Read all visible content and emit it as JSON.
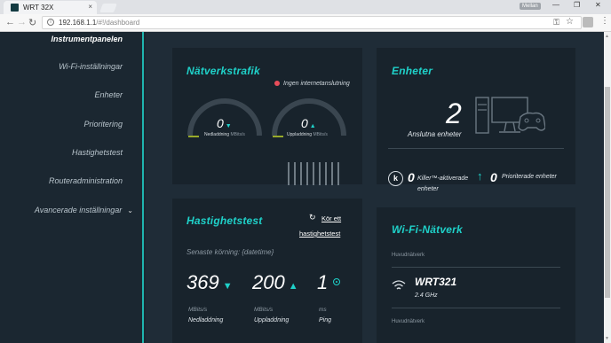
{
  "browser": {
    "tab_title": "WRT 32X",
    "tab_close": "×",
    "user_badge": "Mellan",
    "url_host": "192.168.1.1",
    "url_path": "/#!/dashboard",
    "win_min": "—",
    "win_restore": "❐",
    "win_close": "✕"
  },
  "sidebar": {
    "items": [
      {
        "label": "Instrumentpanelen"
      },
      {
        "label": "Wi-Fi-inställningar"
      },
      {
        "label": "Enheter"
      },
      {
        "label": "Prioritering"
      },
      {
        "label": "Hastighetstest"
      },
      {
        "label": "Routeradministration"
      },
      {
        "label": "Avancerade inställningar"
      }
    ]
  },
  "traffic": {
    "title": "Nätverkstrafik",
    "status": "Ingen internetanslutning",
    "download_value": "0",
    "download_label": "Nedladdning",
    "download_unit": "MBits/s",
    "upload_value": "0",
    "upload_label": "Uppladdning",
    "upload_unit": "MBits/s"
  },
  "devices": {
    "title": "Enheter",
    "connected_count": "2",
    "connected_label": "Anslutna enheter",
    "killer_count": "0",
    "killer_label_line1": "Killer™-aktiverade",
    "killer_label_line2": "enheter",
    "priority_count": "0",
    "priority_label": "Prioriterade enheter"
  },
  "speedtest": {
    "title": "Hastighetstest",
    "run_line1": "Kör ett",
    "run_line2": "hastighetstest",
    "last_run": "Senaste körning: {datetime}",
    "download": "369",
    "download_unit": "MBits/s",
    "download_label": "Nedladdning",
    "upload": "200",
    "upload_unit": "MBits/s",
    "upload_label": "Uppladdning",
    "ping": "1",
    "ping_unit": "ms",
    "ping_label": "Ping"
  },
  "wifi": {
    "title": "Wi-Fi-Nätverk",
    "section1_label": "Huvudnätverk",
    "network_name": "WRT321",
    "network_band": "2.4 GHz",
    "section2_label": "Huvudnätverk"
  },
  "colors": {
    "accent": "#1fd1c9",
    "background": "#1c2832",
    "card": "#18232c",
    "error": "#e84d5a"
  }
}
